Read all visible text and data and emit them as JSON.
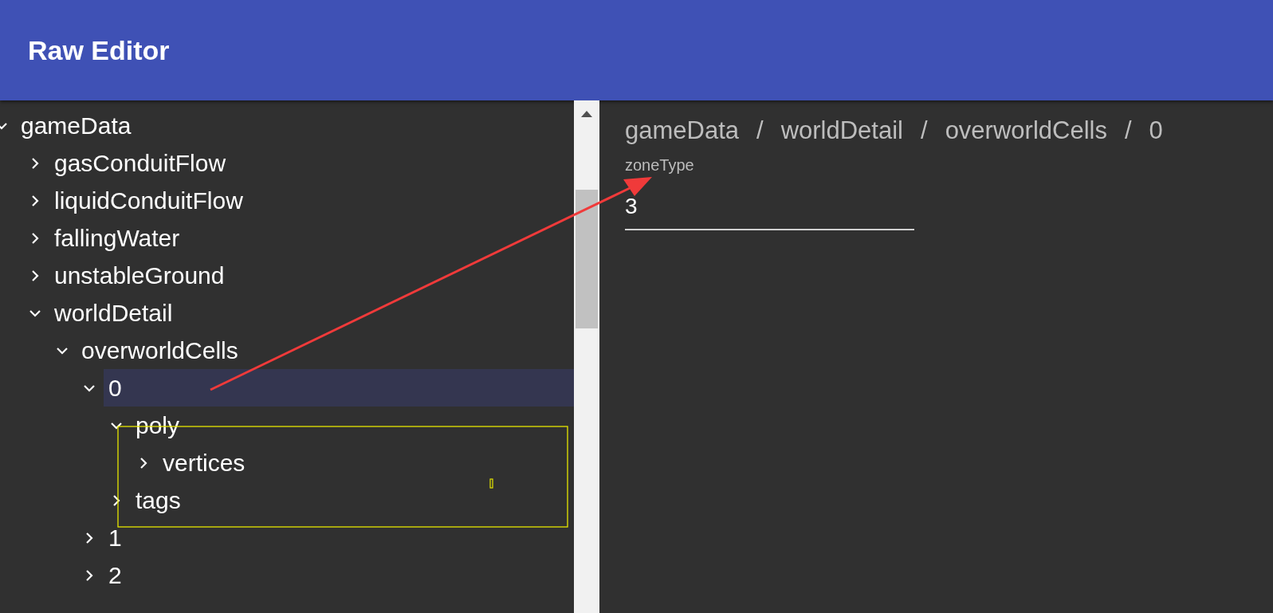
{
  "app_bar": {
    "title": "Raw Editor"
  },
  "tree": [
    {
      "label": "gameData",
      "expanded": true,
      "selected": false,
      "children": [
        {
          "label": "gasConduitFlow",
          "expanded": false,
          "selected": false
        },
        {
          "label": "liquidConduitFlow",
          "expanded": false,
          "selected": false
        },
        {
          "label": "fallingWater",
          "expanded": false,
          "selected": false
        },
        {
          "label": "unstableGround",
          "expanded": false,
          "selected": false
        },
        {
          "label": "worldDetail",
          "expanded": true,
          "selected": false,
          "children": [
            {
              "label": "overworldCells",
              "expanded": true,
              "selected": false,
              "children": [
                {
                  "label": "0",
                  "expanded": true,
                  "selected": true,
                  "children": [
                    {
                      "label": "poly",
                      "expanded": true,
                      "selected": false,
                      "children": [
                        {
                          "label": "vertices",
                          "expanded": false,
                          "selected": false
                        }
                      ]
                    },
                    {
                      "label": "tags",
                      "expanded": false,
                      "selected": false
                    }
                  ]
                },
                {
                  "label": "1",
                  "expanded": false,
                  "selected": false
                },
                {
                  "label": "2",
                  "expanded": false,
                  "selected": false
                }
              ]
            }
          ]
        }
      ]
    }
  ],
  "breadcrumb": {
    "segments": [
      "gameData",
      "worldDetail",
      "overworldCells",
      "0"
    ],
    "separator": "/"
  },
  "field": {
    "label": "zoneType",
    "value": "3"
  }
}
